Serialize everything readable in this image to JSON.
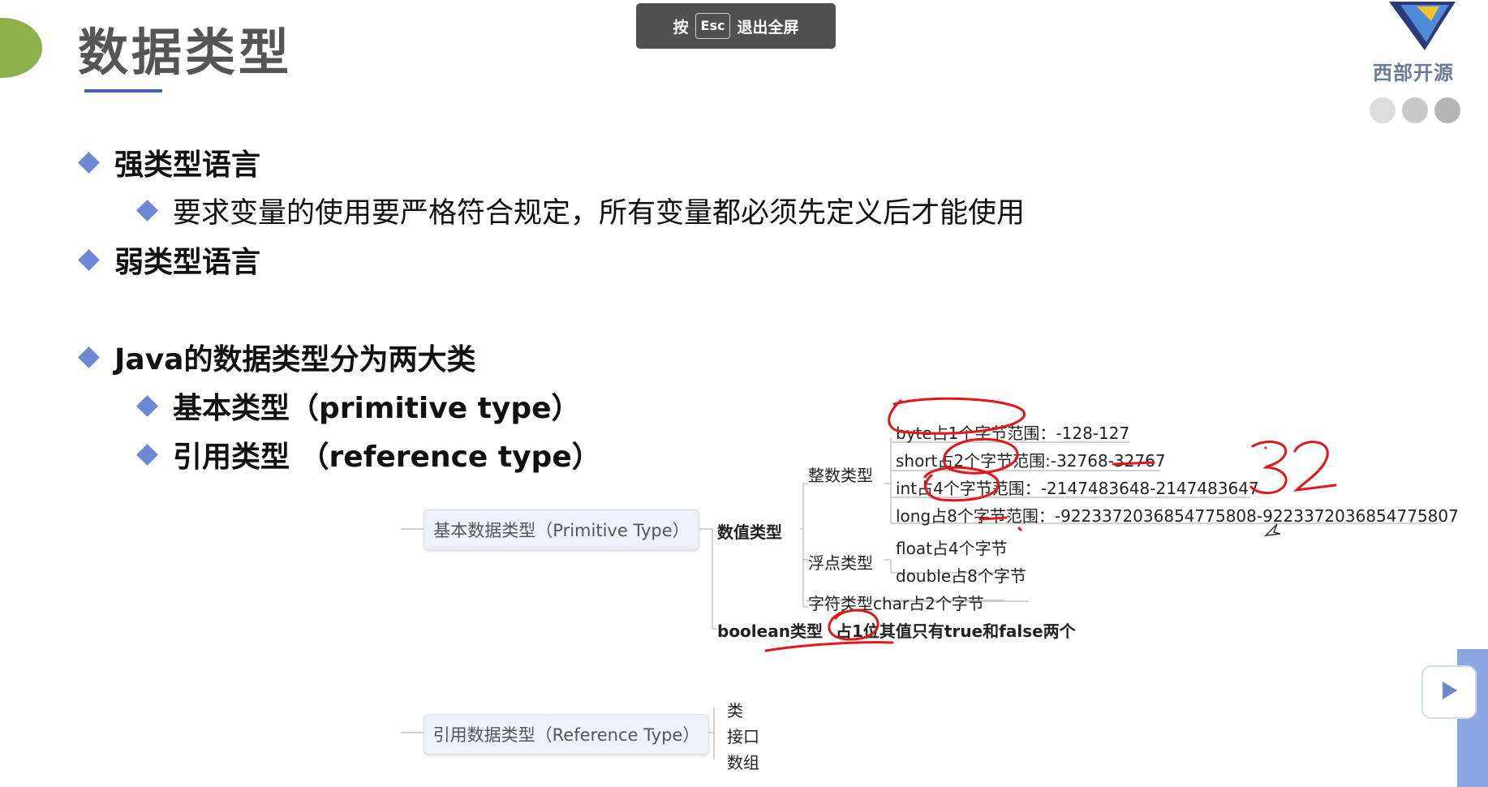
{
  "slide": {
    "title": "数据类型",
    "bullets": {
      "strong": "强类型语言",
      "strong_desc": "要求变量的使用要严格符合规定，所有变量都必须先定义后才能使用",
      "weak": "弱类型语言",
      "java": "Java的数据类型分为两大类",
      "primitive": "基本类型（primitive type）",
      "reference": "引用类型 （reference type）"
    }
  },
  "fullscreen_hint": {
    "prefix": "按",
    "key": "Esc",
    "suffix": "退出全屏"
  },
  "logo": {
    "text": "西部开源"
  },
  "colors": {
    "accent": "#6e86d6",
    "title_underline": "#4a63b0",
    "green": "#8db24c",
    "annotation_red": "#e0181b"
  },
  "mindmap": {
    "primitive_root": "基本数据类型（Primitive Type）",
    "numeric": "数值类型",
    "integer": "整数类型",
    "int_items": [
      "byte占1个字节范围：-128-127",
      "short占2个字节范围:-32768-32767",
      "int占4个字节范围：-2147483648-2147483647",
      "long占8个字节范围：-9223372036854775808-9223372036854775807"
    ],
    "float_group": "浮点类型",
    "float_items": [
      "float占4个字节",
      "double占8个字节"
    ],
    "char_item": "字符类型char占2个字节",
    "boolean": "boolean类型",
    "boolean_desc": "占1位其值只有true和false两个",
    "reference_root": "引用数据类型（Reference Type）",
    "reference_items": [
      "类",
      "接口",
      "数组"
    ]
  },
  "annotation_text": "32",
  "icons": [
    "play-icon",
    "cursor-icon"
  ]
}
